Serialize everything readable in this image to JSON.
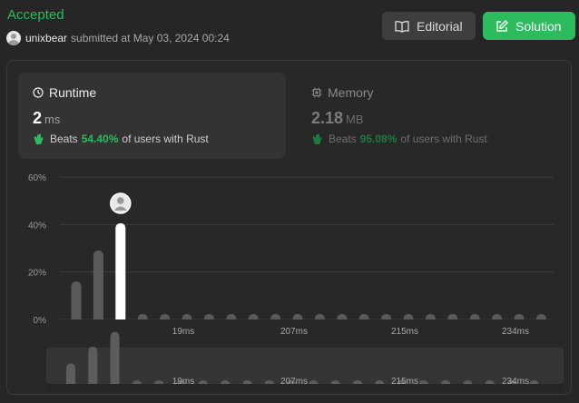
{
  "header": {
    "status": "Accepted",
    "user": "unixbear",
    "submitted_text": "submitted at May 03, 2024 00:24"
  },
  "buttons": {
    "editorial": "Editorial",
    "solution": "Solution"
  },
  "runtime": {
    "title": "Runtime",
    "value": "2",
    "unit": "ms",
    "beats_label": "Beats",
    "beats_pct": "54.40%",
    "beats_suffix": "of users with Rust"
  },
  "memory": {
    "title": "Memory",
    "value": "2.18",
    "unit": "MB",
    "beats_label": "Beats",
    "beats_pct": "95.08%",
    "beats_suffix": "of users with Rust"
  },
  "colors": {
    "accent": "#2cbb5d",
    "bar": "#5a5a5a",
    "bar_highlight": "#ffffff"
  },
  "chart_data": {
    "type": "bar",
    "ylabel": "",
    "xlabel": "",
    "ylim": [
      0,
      60
    ],
    "yticks": [
      "0%",
      "20%",
      "40%",
      "60%"
    ],
    "xtick_labels": [
      {
        "label": "19ms",
        "index": 5
      },
      {
        "label": "207ms",
        "index": 10
      },
      {
        "label": "215ms",
        "index": 15
      },
      {
        "label": "234ms",
        "index": 20
      }
    ],
    "values": [
      16,
      29,
      40.5,
      1.5,
      1.5,
      1.5,
      1.5,
      1.5,
      1.5,
      1.5,
      1.5,
      1.5,
      1.5,
      1.5,
      1.5,
      1.5,
      1.5,
      1.5,
      1.5,
      1.5,
      1.5,
      1.5
    ],
    "highlight_index": 2,
    "grid": true
  }
}
